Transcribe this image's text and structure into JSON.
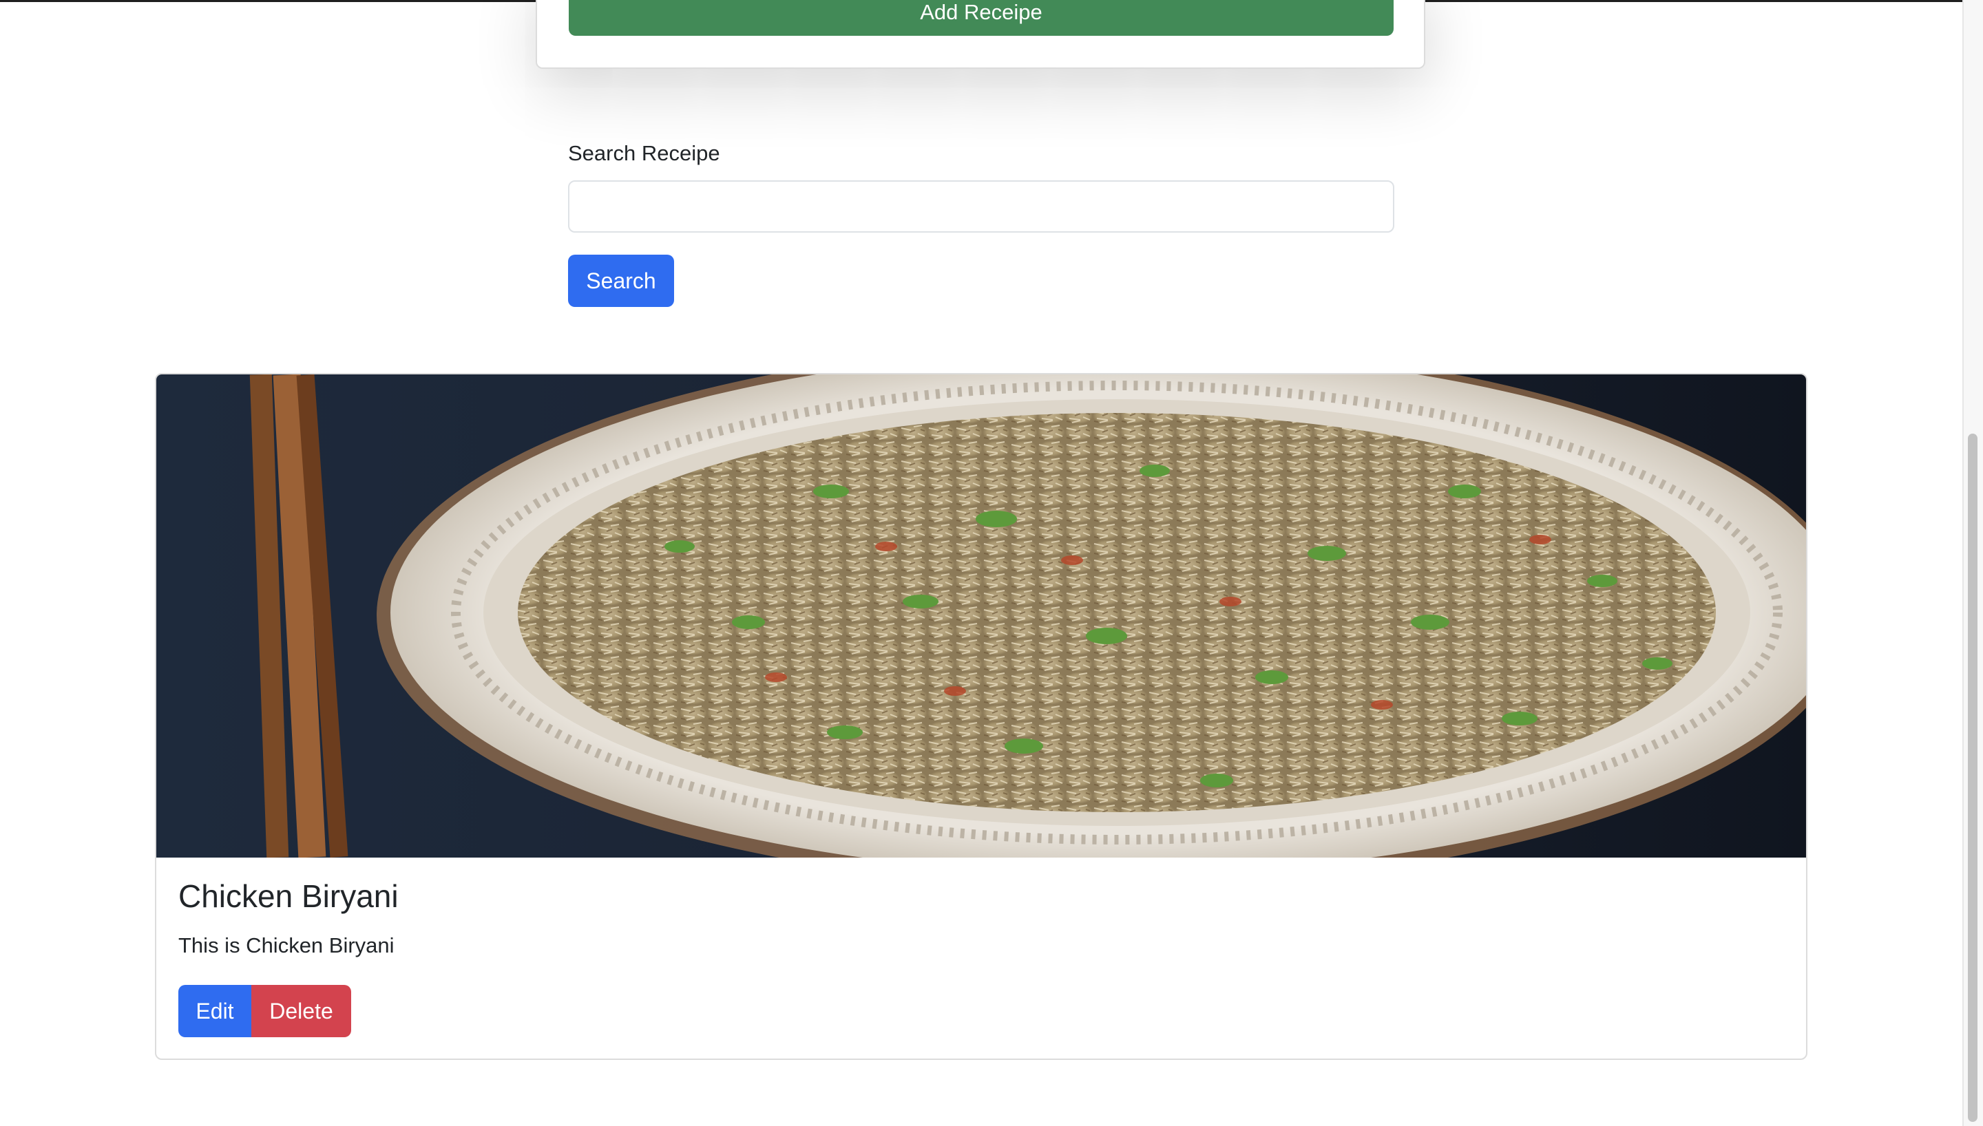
{
  "form": {
    "add_button_label": "Add Receipe"
  },
  "search": {
    "label": "Search Receipe",
    "value": "",
    "placeholder": "",
    "button_label": "Search"
  },
  "recipes": [
    {
      "title": "Chicken Biryani",
      "description": "This is Chicken Biryani",
      "image_icon": "biryani-plate-photo",
      "edit_label": "Edit",
      "delete_label": "Delete"
    }
  ],
  "colors": {
    "success": "#428a57",
    "primary": "#2f6cf0",
    "danger": "#d3434e",
    "text": "#212529"
  }
}
